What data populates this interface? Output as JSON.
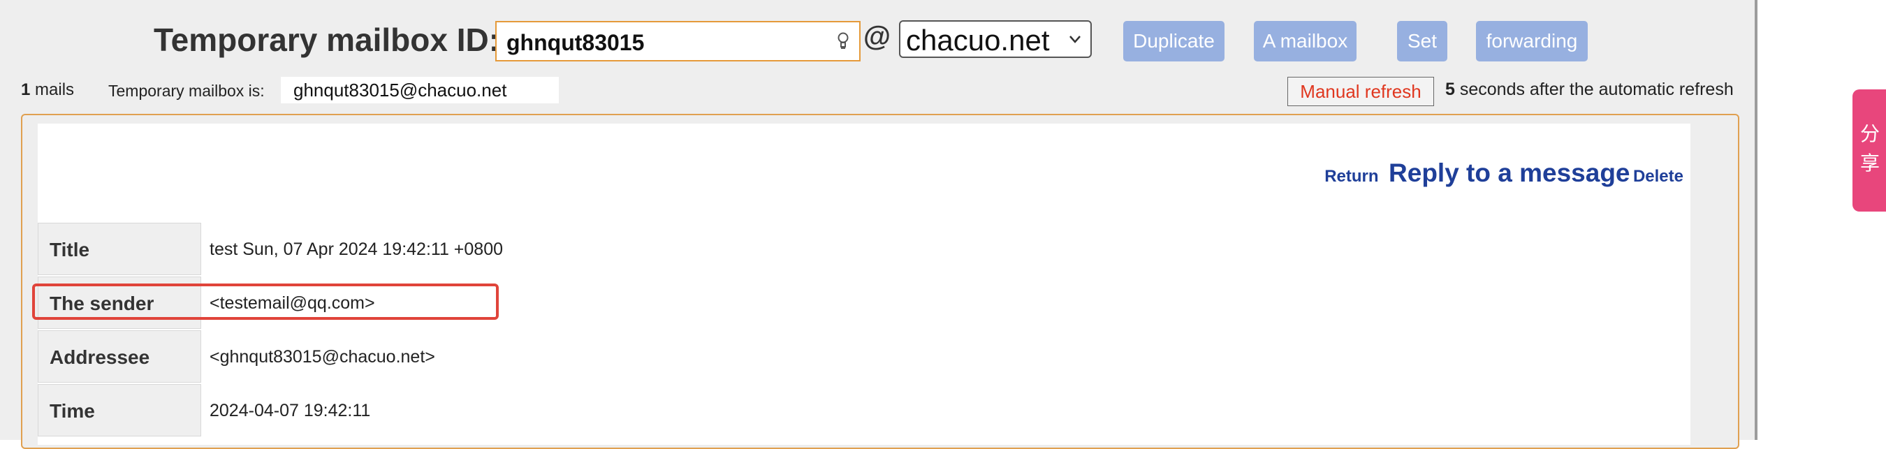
{
  "header": {
    "label": "Temporary mailbox ID:",
    "mailbox_id": "ghnqut83015",
    "at": "@",
    "domain": "chacuo.net",
    "buttons": [
      "Duplicate",
      "A mailbox",
      "Set",
      "forwarding"
    ]
  },
  "status": {
    "mail_count": "1",
    "mail_count_unit": "mails",
    "mailbox_label": "Temporary mailbox is:",
    "mailbox_address": "ghnqut83015@chacuo.net",
    "manual_refresh": "Manual refresh",
    "countdown": "5",
    "auto_refresh_text": "seconds after the automatic refresh"
  },
  "message_actions": {
    "return": "Return",
    "reply": "Reply to a message",
    "delete": "Delete"
  },
  "message": [
    {
      "label": "Title",
      "value": "test Sun, 07 Apr 2024 19:42:11 +0800"
    },
    {
      "label": "The sender",
      "value": "<testemail@qq.com>"
    },
    {
      "label": "Addressee",
      "value": "<ghnqut83015@chacuo.net>"
    },
    {
      "label": "Time",
      "value": "2024-04-07 19:42:11"
    }
  ],
  "share": {
    "text": "分享"
  },
  "colors": {
    "button_blue": "#97b0e0",
    "accent_orange": "#e59a3a",
    "link_blue": "#1f3f99",
    "highlight_red": "#e0443a",
    "share_pink": "#e8467c"
  }
}
